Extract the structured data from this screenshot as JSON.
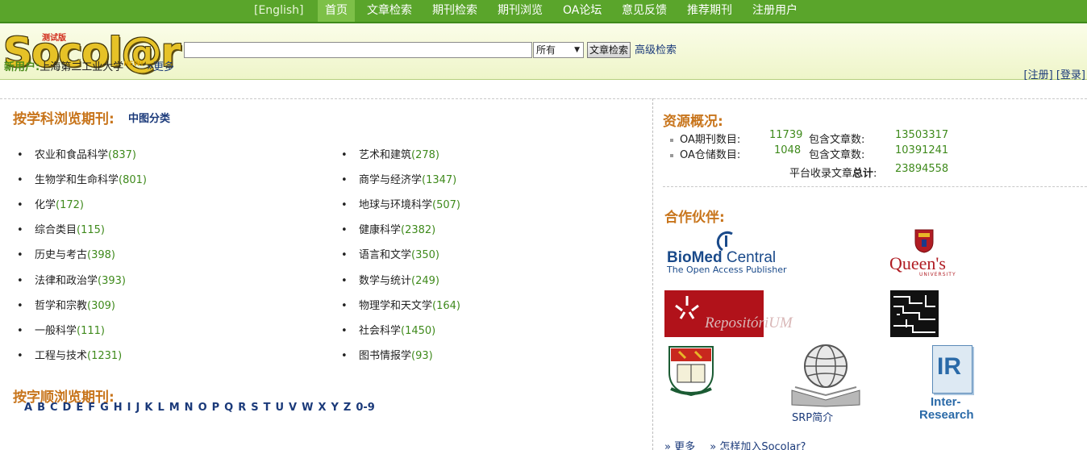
{
  "nav": {
    "english": "[English]",
    "items": [
      "首页",
      "文章检索",
      "期刊检索",
      "期刊浏览",
      "OA论坛",
      "意见反馈",
      "推荐期刊",
      "注册用户"
    ]
  },
  "header": {
    "logo_text": "Socol@r",
    "logo_badge": "测试版",
    "search_input_value": "",
    "search_scope": "所有",
    "search_button": "文章检索",
    "advanced_search": "高级检索",
    "register": "注册",
    "login": "登录",
    "new_user_label": "新用户:",
    "new_user_name": "上海第二工业大学",
    "new_badge": "NEW!",
    "more": "»更多"
  },
  "browse_subject": {
    "title": "按学科浏览期刊:",
    "classification_link": "中图分类",
    "left_column": [
      {
        "name": "农业和食品科学",
        "count": "(837)"
      },
      {
        "name": "生物学和生命科学",
        "count": "(801)"
      },
      {
        "name": "化学",
        "count": "(172)"
      },
      {
        "name": "综合类目",
        "count": "(115)"
      },
      {
        "name": "历史与考古",
        "count": "(398)"
      },
      {
        "name": "法律和政治学",
        "count": "(393)"
      },
      {
        "name": "哲学和宗教",
        "count": "(309)"
      },
      {
        "name": "一般科学",
        "count": "(111)"
      },
      {
        "name": "工程与技术",
        "count": "(1231)"
      }
    ],
    "right_column": [
      {
        "name": "艺术和建筑",
        "count": "(278)"
      },
      {
        "name": "商学与经济学",
        "count": "(1347)"
      },
      {
        "name": "地球与环境科学",
        "count": "(507)"
      },
      {
        "name": "健康科学",
        "count": "(2382)"
      },
      {
        "name": "语言和文学",
        "count": "(350)"
      },
      {
        "name": "数学与统计",
        "count": "(249)"
      },
      {
        "name": "物理学和天文学",
        "count": "(164)"
      },
      {
        "name": "社会科学",
        "count": "(1450)"
      },
      {
        "name": "图书情报学",
        "count": "(93)"
      }
    ]
  },
  "browse_alpha": {
    "title": "按字顺浏览期刊:",
    "letters": [
      "A",
      "B",
      "C",
      "D",
      "E",
      "F",
      "G",
      "H",
      "I",
      "J",
      "K",
      "L",
      "M",
      "N",
      "O",
      "P",
      "Q",
      "R",
      "S",
      "T",
      "U",
      "V",
      "W",
      "X",
      "Y",
      "Z",
      "0-9"
    ]
  },
  "resources": {
    "title": "资源概况:",
    "oa_journals_label": "OA期刊数目:",
    "oa_journals_value": "11739",
    "oa_journals_articles_label": "包含文章数:",
    "oa_journals_articles_value": "13503317",
    "oa_repos_label": "OA仓储数目:",
    "oa_repos_value": "1048",
    "oa_repos_articles_label": "包含文章数:",
    "oa_repos_articles_value": "10391241",
    "total_label_prefix": "平台收录文章",
    "total_label_strong": "总计",
    "total_label_suffix": ":",
    "total_value": "23894558"
  },
  "partners": {
    "title": "合作伙伴:",
    "biomed_name_a": "BioMed",
    "biomed_name_b": " Central",
    "biomed_tagline": "The Open Access Publisher",
    "queens_name": "Queen's",
    "queens_sub": "UNIVERSITY",
    "repositorium": "RepositóriUM",
    "srp_caption": "SRP简介",
    "ir_letters": "IR",
    "ir_name_a": "Inter-",
    "ir_name_b": "Research",
    "more": "» 更多",
    "how_join": "» 怎样加入Socolar?"
  },
  "colors": {
    "nav_green": "#5aa52b",
    "section_orange": "#c8751c",
    "count_green": "#3f8a1c",
    "link_blue": "#1b3a7a"
  }
}
